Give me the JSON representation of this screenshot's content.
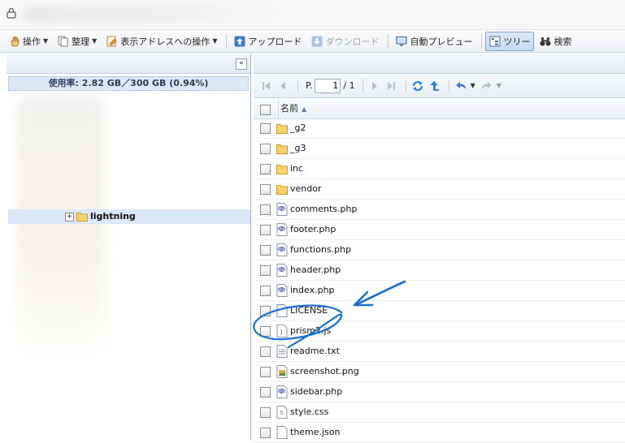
{
  "toolbar": {
    "items": [
      {
        "label": "操作",
        "has_menu": true
      },
      {
        "label": "整理",
        "has_menu": true
      },
      {
        "label": "表示アドレスへの操作",
        "has_menu": true
      },
      {
        "label": "アップロード",
        "disabled": false
      },
      {
        "label": "ダウンロード",
        "disabled": true
      },
      {
        "label": "自動プレビュー"
      },
      {
        "label": "ツリー",
        "active": true
      },
      {
        "label": "検索"
      }
    ]
  },
  "sidebar": {
    "usage": "使用率: 2.82 GB／300 GB (0.94%)",
    "collapse_glyph": "«",
    "selected_folder": "lightning"
  },
  "pager": {
    "page_prefix": "P.",
    "current_page": "1",
    "total_text": "/ 1"
  },
  "grid": {
    "column_name": "名前",
    "sort_glyph": "▲",
    "files": [
      {
        "name": "_g2",
        "icon": "folder-icon"
      },
      {
        "name": "_g3",
        "icon": "folder-icon"
      },
      {
        "name": "inc",
        "icon": "folder-icon"
      },
      {
        "name": "vendor",
        "icon": "folder-icon"
      },
      {
        "name": "comments.php",
        "icon": "php-file-icon"
      },
      {
        "name": "footer.php",
        "icon": "php-file-icon"
      },
      {
        "name": "functions.php",
        "icon": "php-file-icon"
      },
      {
        "name": "header.php",
        "icon": "php-file-icon"
      },
      {
        "name": "index.php",
        "icon": "php-file-icon"
      },
      {
        "name": "LICENSE",
        "icon": "blank-file-icon"
      },
      {
        "name": "prism2.js",
        "icon": "js-file-icon"
      },
      {
        "name": "readme.txt",
        "icon": "text-file-icon"
      },
      {
        "name": "screenshot.png",
        "icon": "image-file-icon"
      },
      {
        "name": "sidebar.php",
        "icon": "php-file-icon"
      },
      {
        "name": "style.css",
        "icon": "css-file-icon"
      },
      {
        "name": "theme.json",
        "icon": "blank-file-icon"
      }
    ]
  },
  "colors": {
    "accent": "#1f6fd1",
    "annotation": "#1a6fd0",
    "selection": "#dbe8f8"
  }
}
